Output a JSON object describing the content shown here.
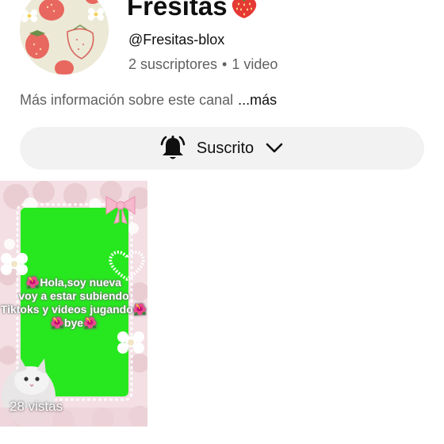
{
  "channel": {
    "name": "Fresitas",
    "handle": "@Fresitas-blox",
    "subscribers": "2 suscriptores",
    "separator": "•",
    "video_count": "1 video",
    "about_text": "Más información sobre este canal",
    "about_more": "...más"
  },
  "subscribe_button": {
    "label": "Suscrito",
    "icon": "bell-icon",
    "chevron": "chevron-down-icon"
  },
  "videos": [
    {
      "caption_lines": [
        "🌺Hola,soy nueva",
        "voy a estar subiendo",
        "Tiktoks y videos jugando🌺",
        "🌺bye🌺"
      ],
      "views": "28 vistas"
    }
  ],
  "colors": {
    "text_primary": "#0f0f0f",
    "text_secondary": "#606060",
    "button_bg": "#f2f2f2",
    "thumb_green": "#27e81f",
    "strawberry": "#e53935"
  }
}
